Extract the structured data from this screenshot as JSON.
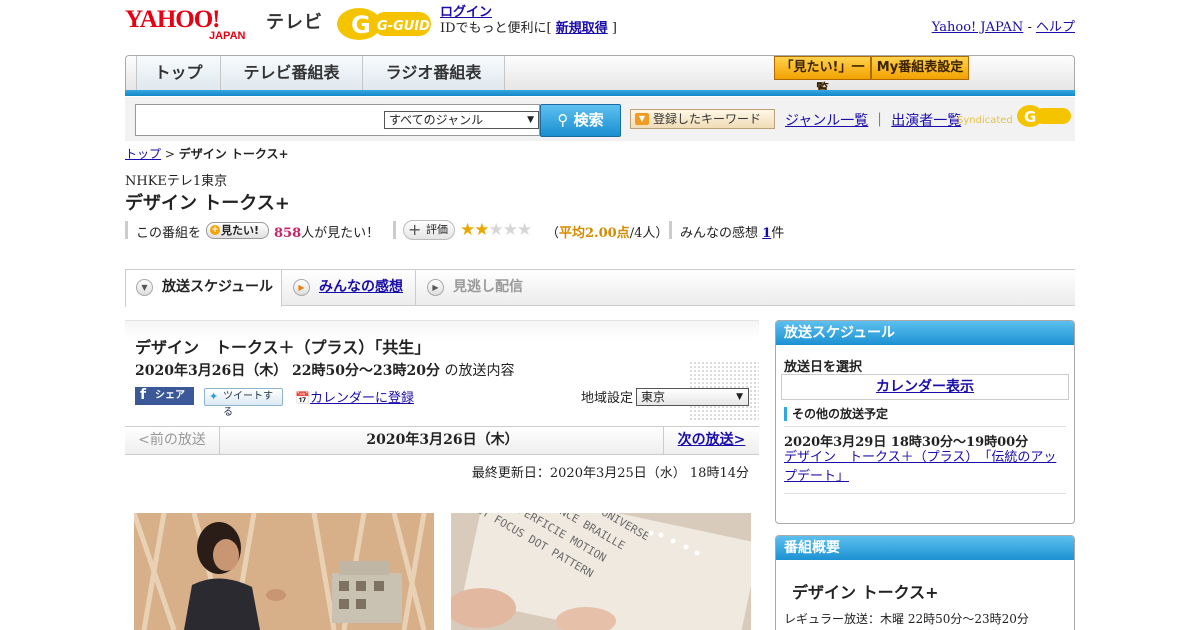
{
  "header": {
    "logo_yahoo_text": "YAHOO!",
    "logo_japan_text": "JAPAN",
    "logo_tv": "テレビ",
    "logo_gguide_text": "G-GUIDE",
    "login": "ログイン",
    "id_text": "IDでもっと便利に[ ",
    "signup": "新規取得",
    "id_close": " ]",
    "yahoo_japan": "Yahoo! JAPAN",
    "sep": " - ",
    "help": "ヘルプ"
  },
  "nav": {
    "tabs": [
      "トップ",
      "テレビ番組表",
      "ラジオ番組表"
    ],
    "mitai_list": "「見たい!」一覧",
    "my_schedule": "My番組表設定"
  },
  "search": {
    "genre": "すべてのジャンル",
    "button": "検索",
    "keyword_button": "登録したキーワード",
    "genre_list": "ジャンル一覧",
    "divider": "｜",
    "performer_list": "出演者一覧",
    "syndicated": "Syndicated"
  },
  "breadcrumb": {
    "top": "トップ",
    "sep": " > ",
    "current": "デザイン トークス+"
  },
  "program": {
    "channel": "NHKEテレ1東京",
    "title": "デザイン トークス+",
    "mitai_prefix": "この番組を",
    "mitai_btn": "見たい!",
    "mitai_count": "858",
    "mitai_suffix": "人が見たい！",
    "rate_btn": "評価",
    "stars": 2,
    "rating_open": "（",
    "rating_avg": "平均2.00点",
    "rating_people": "/4人）",
    "impressions_label": "みんなの感想 ",
    "impressions_count": "1",
    "impressions_unit": "件"
  },
  "content_tabs": [
    "放送スケジュール",
    "みんなの感想",
    "見逃し配信"
  ],
  "episode": {
    "title": "デザイン　トークス＋（プラス）「共生」",
    "datetime": "2020年3月26日（木）  22時50分～23時20分",
    "datetime_suffix": " の放送内容",
    "share": "シェア",
    "tweet": "ツイートする",
    "calendar": "カレンダーに登録",
    "region_label": "地域設定",
    "region": "東京"
  },
  "pager": {
    "prev": "<前の放送",
    "date": "2020年3月26日（木）",
    "next": "次の放送>"
  },
  "updated": "最終更新日：2020年3月25日（水）  18時14分",
  "sidebar": {
    "schedule_header": "放送スケジュール",
    "select_date": "放送日を選択",
    "calendar": "カレンダー表示",
    "other_label": "その他の放送予定",
    "other_date": "2020年3月29日  18時30分～19時00分",
    "other_title": "デザイン　トークス＋（プラス）　「伝統のアップデート」",
    "summary_header": "番組概要",
    "summary_title": "デザイン トークス+",
    "regular": "レギュラー放送：木曜 22時50分～23時20分"
  },
  "colors": {
    "accent_blue": "#1c91d2",
    "nav_orange": "#f2a200",
    "link": "#1a0dab",
    "star": "#e8a800"
  }
}
